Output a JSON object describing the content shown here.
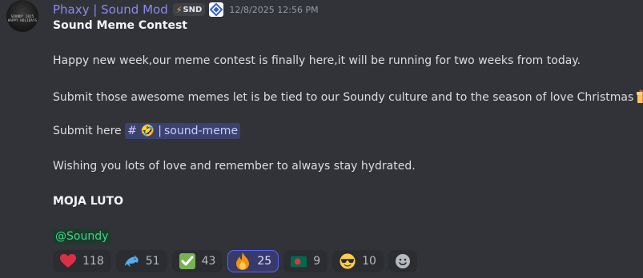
{
  "message": {
    "author": {
      "username": "Phaxy | Sound Mod",
      "tag": "SND",
      "avatar_text": [
        "SOUNDY 2025",
        "HAPPY HOLIDAYS"
      ],
      "name_color": "#8e88f0"
    },
    "timestamp": "12/8/2025 12:56 PM",
    "title": "Sound Meme Contest",
    "paragraph1": "Happy new week,our meme contest is finally here,it will be running for two weeks from today.",
    "paragraph2": "Submit those awesome memes let is be tied to our Soundy culture and to the season of love Christmas",
    "paragraph2_end": ".",
    "submit_prefix": "Submit here",
    "channel": {
      "icon": "hash-icon",
      "emoji": "🤣",
      "name": "sound-meme"
    },
    "paragraph4": "Wishing you lots of love and remember to always stay hydrated.",
    "signoff": "MOJA LUTO",
    "mention": "@Soundy"
  },
  "reactions": [
    {
      "icon": "heart-icon",
      "count": "118",
      "active": false
    },
    {
      "icon": "dolphin-icon",
      "count": "51",
      "active": false
    },
    {
      "icon": "check-mark-icon",
      "count": "43",
      "active": false
    },
    {
      "icon": "fire-icon",
      "count": "25",
      "active": true
    },
    {
      "icon": "bangladesh-flag-icon",
      "count": "9",
      "active": false
    },
    {
      "icon": "sunglasses-face-icon",
      "count": "10",
      "active": false
    }
  ],
  "add_reaction_icon": "add-reaction-icon",
  "colors": {
    "background": "#313338",
    "active_reaction": "#5865f2",
    "mention_text": "#3dd68c",
    "channel_bg": "#3c4270"
  }
}
